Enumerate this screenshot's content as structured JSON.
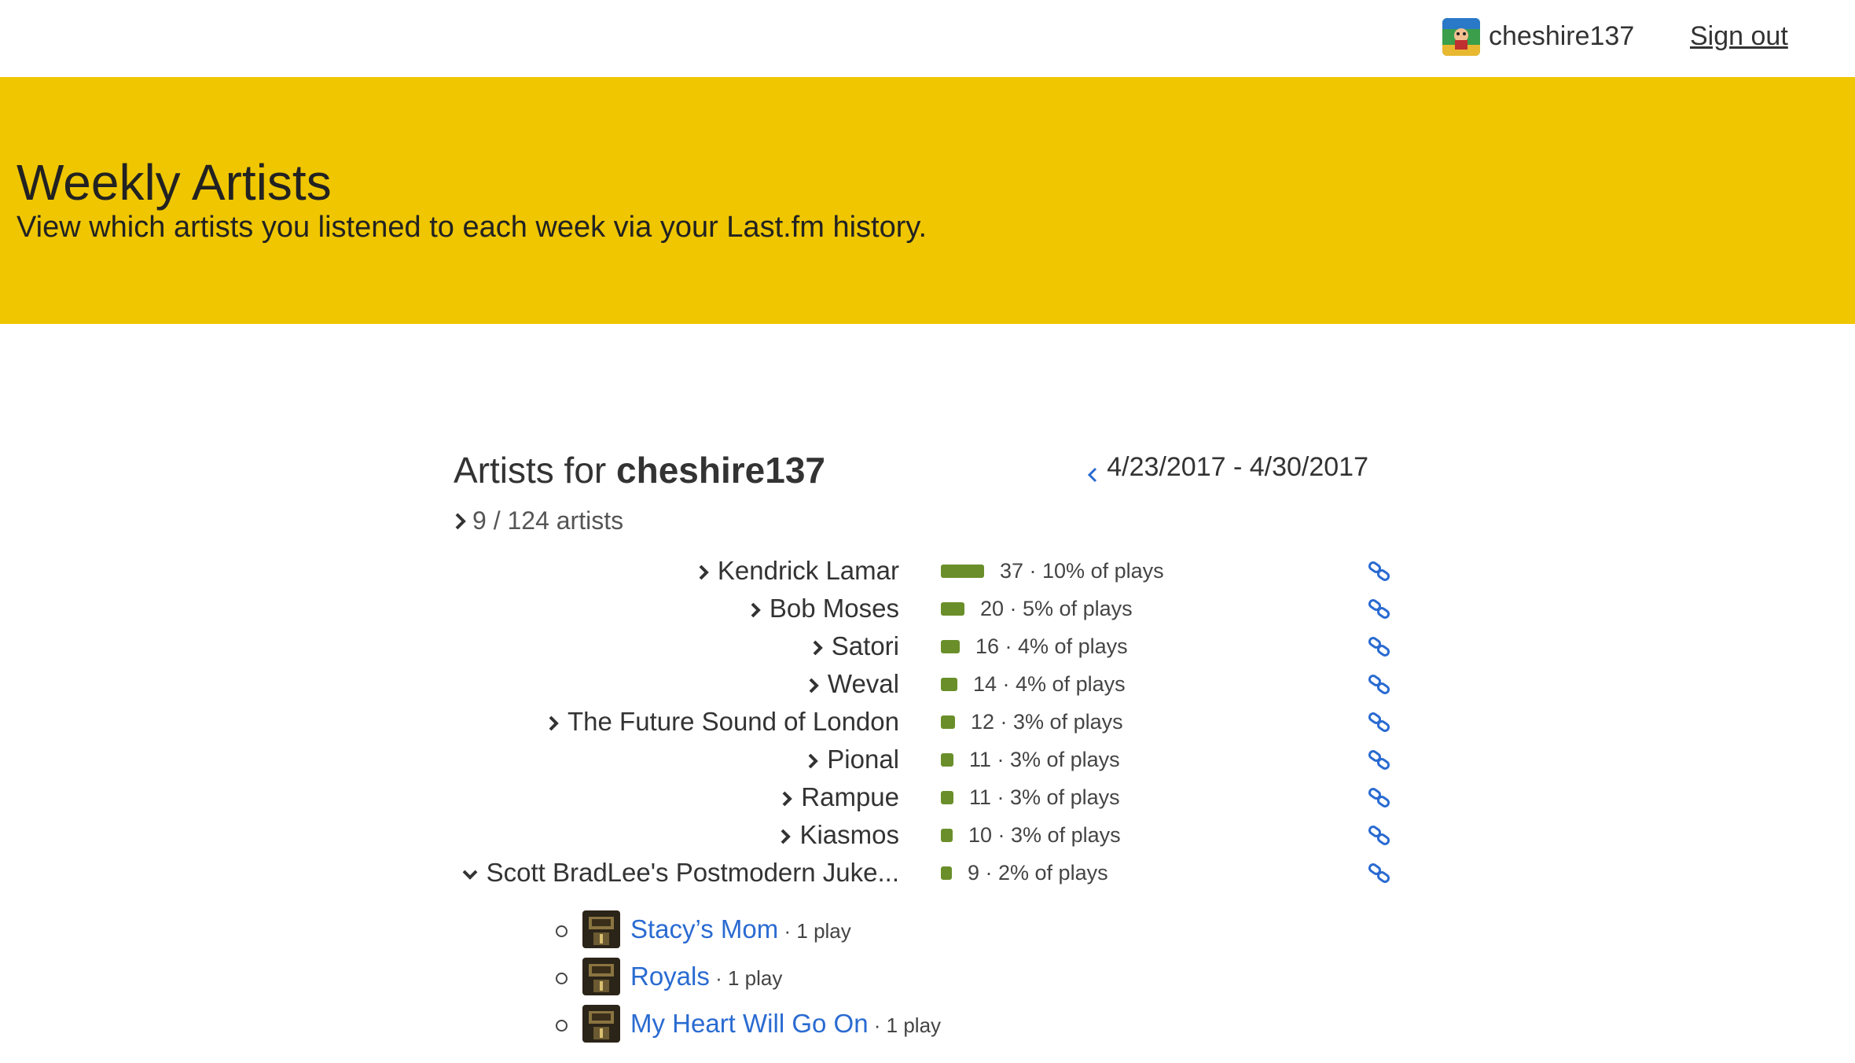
{
  "header": {
    "username": "cheshire137",
    "signout_label": "Sign out",
    "avatar_icon": "user-avatar"
  },
  "hero": {
    "title": "Weekly Artists",
    "subtitle": "View which artists you listened to each week via your Last.fm history.",
    "color": "#efc600"
  },
  "main": {
    "heading_prefix": "Artists for ",
    "heading_user": "cheshire137",
    "date_range": "4/23/2017 - 4/30/2017",
    "summary": "9 / 124 artists",
    "bar_color": "#6a8f2a",
    "link_color": "#2a6bd1",
    "artists": [
      {
        "name": "Kendrick Lamar",
        "count": "37 · 10% of plays",
        "plays": 37,
        "expanded": false
      },
      {
        "name": "Bob Moses",
        "count": "20 · 5% of plays",
        "plays": 20,
        "expanded": false
      },
      {
        "name": "Satori",
        "count": "16 · 4% of plays",
        "plays": 16,
        "expanded": false
      },
      {
        "name": "Weval",
        "count": "14 · 4% of plays",
        "plays": 14,
        "expanded": false
      },
      {
        "name": "The Future Sound of London",
        "count": "12 · 3% of plays",
        "plays": 12,
        "expanded": false
      },
      {
        "name": "Pional",
        "count": "11 · 3% of plays",
        "plays": 11,
        "expanded": false
      },
      {
        "name": "Rampue",
        "count": "11 · 3% of plays",
        "plays": 11,
        "expanded": false
      },
      {
        "name": "Kiasmos",
        "count": "10 · 3% of plays",
        "plays": 10,
        "expanded": false
      },
      {
        "name": "Scott BradLee's Postmodern Juke...",
        "count": "9 · 2% of plays",
        "plays": 9,
        "expanded": true
      }
    ],
    "tracks": [
      {
        "title": "Stacy’s Mom",
        "plays": " · 1 play"
      },
      {
        "title": "Royals",
        "plays": " · 1 play"
      },
      {
        "title": "My Heart Will Go On",
        "plays": " · 1 play"
      }
    ]
  }
}
